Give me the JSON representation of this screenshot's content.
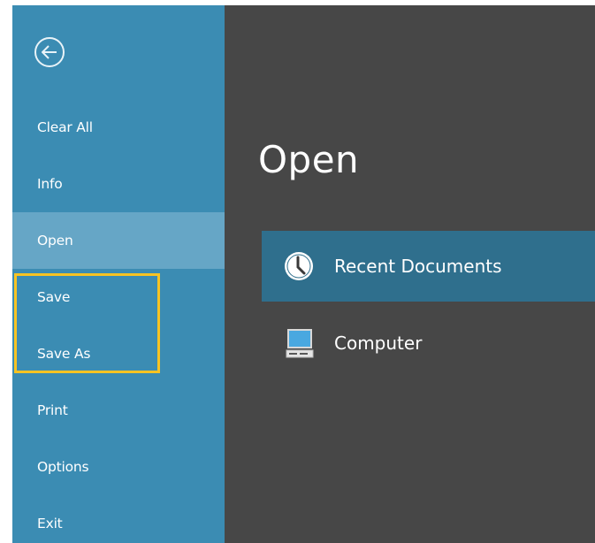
{
  "sidebar": {
    "back_icon": "back-arrow-icon",
    "items": [
      {
        "label": "Clear All"
      },
      {
        "label": "Info"
      },
      {
        "label": "Open",
        "active": true
      },
      {
        "label": "Save"
      },
      {
        "label": "Save As"
      },
      {
        "label": "Print"
      },
      {
        "label": "Options"
      },
      {
        "label": "Exit"
      }
    ]
  },
  "main": {
    "title": "Open",
    "locations": [
      {
        "label": "Recent Documents",
        "icon": "clock-icon",
        "selected": true
      },
      {
        "label": "Computer",
        "icon": "computer-icon",
        "selected": false
      }
    ]
  },
  "colors": {
    "sidebar_bg": "#3b8cb3",
    "sidebar_active": "#66a6c6",
    "main_bg": "#474747",
    "selected_location": "#2f6f8d",
    "highlight_outline": "#f7c323"
  }
}
